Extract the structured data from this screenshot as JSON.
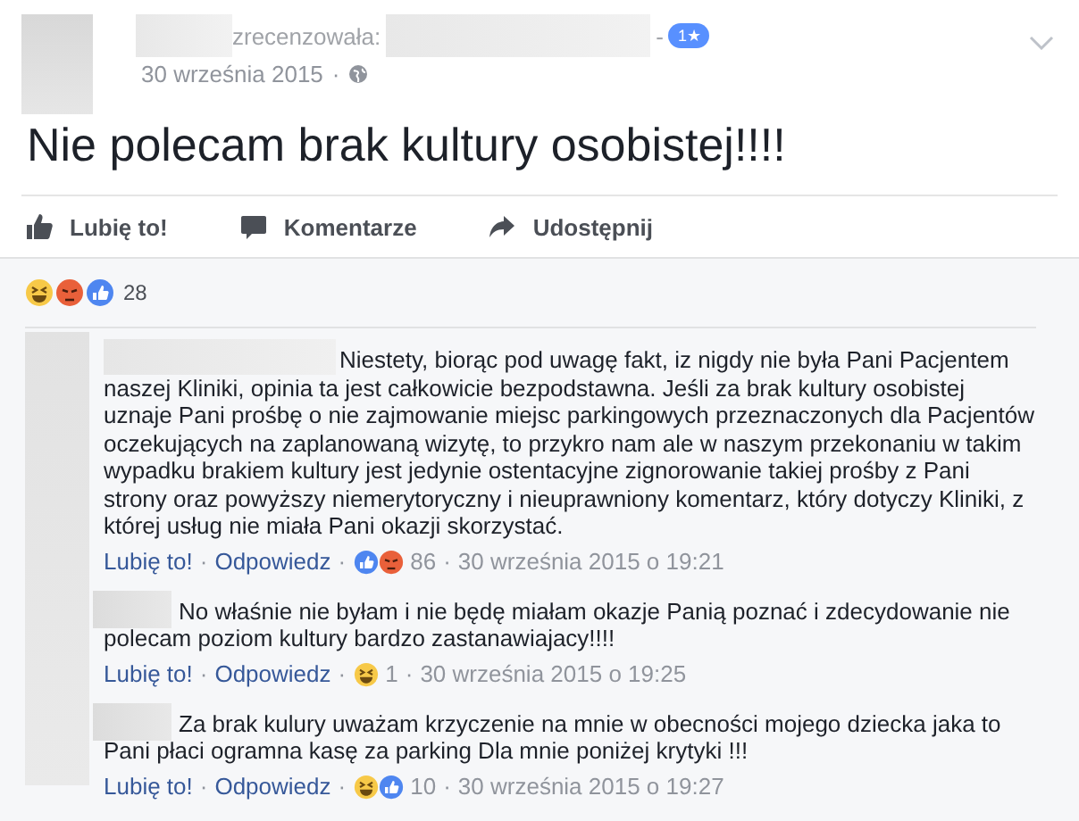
{
  "post": {
    "header": {
      "action": "zrecenzowała:",
      "separator": "-",
      "rating_badge": "1★",
      "date": "30 września 2015",
      "date_separator": "·"
    },
    "text": "Nie polecam brak kultury osobistej!!!!",
    "actions": [
      {
        "kind": "like",
        "label": "Lubię to!"
      },
      {
        "kind": "comment",
        "label": "Komentarze"
      },
      {
        "kind": "share",
        "label": "Udostępnij"
      }
    ]
  },
  "reactions": {
    "icons": [
      {
        "kind": "haha"
      },
      {
        "kind": "angry"
      },
      {
        "kind": "like"
      }
    ],
    "count": "28"
  },
  "comments": [
    {
      "kind": "name",
      "text": "Niestety, biorąc pod uwagę fakt, iz nigdy nie była Pani Pacjentem naszej Kliniki, opinia ta jest całkowicie bezpodstawna. Jeśli za brak kultury osobistej uznaje Pani prośbę o nie zajmowanie miejsc parkingowych przeznaczonych dla Pacjentów oczekujących na zaplanowaną wizytę, to przykro nam ale w naszym przekonaniu w takim wypadku brakiem kultury jest jedynie ostentacyjne zignorowanie takiej prośby z Pani strony oraz powyższy niemerytoryczny i nieuprawniony komentarz, który dotyczy Kliniki, z której usług nie miała Pani okazji skorzystać.",
      "like": "Lubię to!",
      "separators": [
        "·",
        "·",
        "·"
      ],
      "reply": "Odpowiedz",
      "reactions": [
        {
          "kind": "like"
        },
        {
          "kind": "angry"
        }
      ],
      "count": "86",
      "time": "30 września 2015 o 19:21"
    },
    {
      "kind": "avatar",
      "text": "No właśnie nie byłam i nie będę miałam okazje Panią poznać i zdecydowanie nie polecam poziom kultury bardzo zastanawiajacy!!!!",
      "like": "Lubię to!",
      "separators": [
        "·",
        "·",
        "·"
      ],
      "reply": "Odpowiedz",
      "reactions": [
        {
          "kind": "haha"
        }
      ],
      "count": "1",
      "time": "30 września 2015 o 19:25"
    },
    {
      "kind": "avatar",
      "text": "Za brak kulury uważam krzyczenie na mnie w obecności mojego dziecka jaka to Pani płaci ogramna kasę za parking Dla mnie poniżej krytyki !!!",
      "like": "Lubię to!",
      "separators": [
        "·",
        "·",
        "·"
      ],
      "reply": "Odpowiedz",
      "reactions": [
        {
          "kind": "haha"
        },
        {
          "kind": "like"
        }
      ],
      "count": "10",
      "time": "30 września 2015 o 19:27"
    }
  ]
}
